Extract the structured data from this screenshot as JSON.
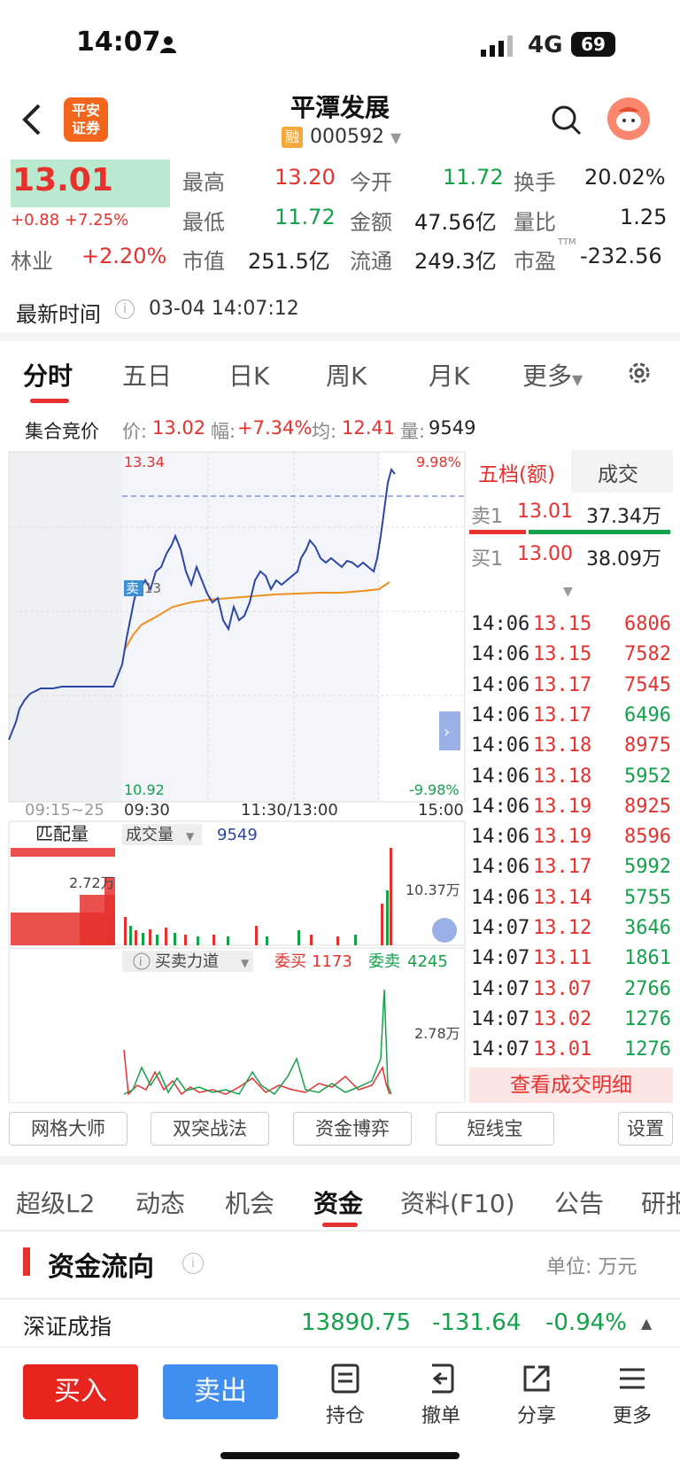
{
  "status_bar": {
    "time": "14:07",
    "network": "4G",
    "battery": "69"
  },
  "header": {
    "stock_name": "平潭发展",
    "stock_code": "000592",
    "margin_badge": "融",
    "broker_logo": "平安\n证券"
  },
  "quote": {
    "price": "13.01",
    "change": "+0.88",
    "change_pct": "+7.25%",
    "sector_name": "林业",
    "sector_pct": "+2.20%",
    "high_label": "最高",
    "high": "13.20",
    "open_label": "今开",
    "open": "11.72",
    "turnover_label": "换手",
    "turnover": "20.02%",
    "low_label": "最低",
    "low": "11.72",
    "amount_label": "金额",
    "amount": "47.56亿",
    "vol_ratio_label": "量比",
    "vol_ratio": "1.25",
    "mktcap_label": "市值",
    "mktcap": "251.5亿",
    "float_label": "流通",
    "float": "249.3亿",
    "pe_label": "市盈",
    "pe_sup": "TTM",
    "pe": "-232.56",
    "update_label": "最新时间",
    "update_time": "03-04 14:07:12"
  },
  "chart_tabs": [
    "分时",
    "五日",
    "日K",
    "周K",
    "月K",
    "更多"
  ],
  "auction_bar": {
    "title": "集合竞价",
    "price_label": "价:",
    "price": "13.02",
    "range_label": "幅:",
    "range": "+7.34%",
    "avg_label": "均:",
    "avg": "12.41",
    "vol_label": "量:",
    "vol": "9549"
  },
  "chart_labels": {
    "top_price": "13.34",
    "top_pct": "9.98%",
    "bottom_price": "10.92",
    "bottom_pct": "-9.98%",
    "sell_marker": "卖",
    "sell_marker_val": "13",
    "t0": "09:15~25",
    "t1": "09:30",
    "t2": "11:30/13:00",
    "t3": "15:00",
    "match_vol": "匹配量",
    "trade_vol": "成交量",
    "trade_vol_val": "9549",
    "match_vol_max": "2.72万",
    "vol_max": "10.37万",
    "force_label": "买卖力道",
    "entrust_buy_label": "委买",
    "entrust_buy": "1173",
    "entrust_sell_label": "委卖",
    "entrust_sell": "4245",
    "force_max": "2.78万"
  },
  "order_book": {
    "tab_level": "五档(额)",
    "tab_trades": "成交",
    "sell1_label": "卖1",
    "sell1_price": "13.01",
    "sell1_amt": "37.34万",
    "buy1_label": "买1",
    "buy1_price": "13.00",
    "buy1_amt": "38.09万",
    "details_btn": "查看成交明细"
  },
  "trades": [
    {
      "t": "14:06",
      "p": "13.15",
      "v": "6806",
      "side": "sell"
    },
    {
      "t": "14:06",
      "p": "13.15",
      "v": "7582",
      "side": "sell"
    },
    {
      "t": "14:06",
      "p": "13.17",
      "v": "7545",
      "side": "sell"
    },
    {
      "t": "14:06",
      "p": "13.17",
      "v": "6496",
      "side": "buy"
    },
    {
      "t": "14:06",
      "p": "13.18",
      "v": "8975",
      "side": "sell"
    },
    {
      "t": "14:06",
      "p": "13.18",
      "v": "5952",
      "side": "buy"
    },
    {
      "t": "14:06",
      "p": "13.19",
      "v": "8925",
      "side": "sell"
    },
    {
      "t": "14:06",
      "p": "13.19",
      "v": "8596",
      "side": "sell"
    },
    {
      "t": "14:06",
      "p": "13.17",
      "v": "5992",
      "side": "buy"
    },
    {
      "t": "14:06",
      "p": "13.14",
      "v": "5755",
      "side": "buy"
    },
    {
      "t": "14:07",
      "p": "13.12",
      "v": "3646",
      "side": "buy"
    },
    {
      "t": "14:07",
      "p": "13.11",
      "v": "1861",
      "side": "buy"
    },
    {
      "t": "14:07",
      "p": "13.07",
      "v": "2766",
      "side": "buy"
    },
    {
      "t": "14:07",
      "p": "13.02",
      "v": "1276",
      "side": "buy"
    },
    {
      "t": "14:07",
      "p": "13.01",
      "v": "1276",
      "side": "buy"
    }
  ],
  "tools": [
    "网格大师",
    "双突战法",
    "资金博弈",
    "短线宝",
    "设置"
  ],
  "info_tabs": [
    "超级L2",
    "动态",
    "机会",
    "资金",
    "资料(F10)",
    "公告",
    "研报"
  ],
  "fund_flow": {
    "title": "资金流向",
    "unit": "单位: 万元"
  },
  "index": {
    "name": "深证成指",
    "value": "13890.75",
    "change": "-131.64",
    "pct": "-0.94%"
  },
  "bottom_bar": {
    "buy": "买入",
    "sell": "卖出",
    "position": "持仓",
    "cancel": "撤单",
    "share": "分享",
    "more": "更多"
  },
  "colors": {
    "up": "#e6312e",
    "down": "#12a24a",
    "price_line": "#2b46a8",
    "avg_line": "#f0901e",
    "buy_btn": "#e8241f",
    "sell_btn": "#3f8ef0"
  }
}
